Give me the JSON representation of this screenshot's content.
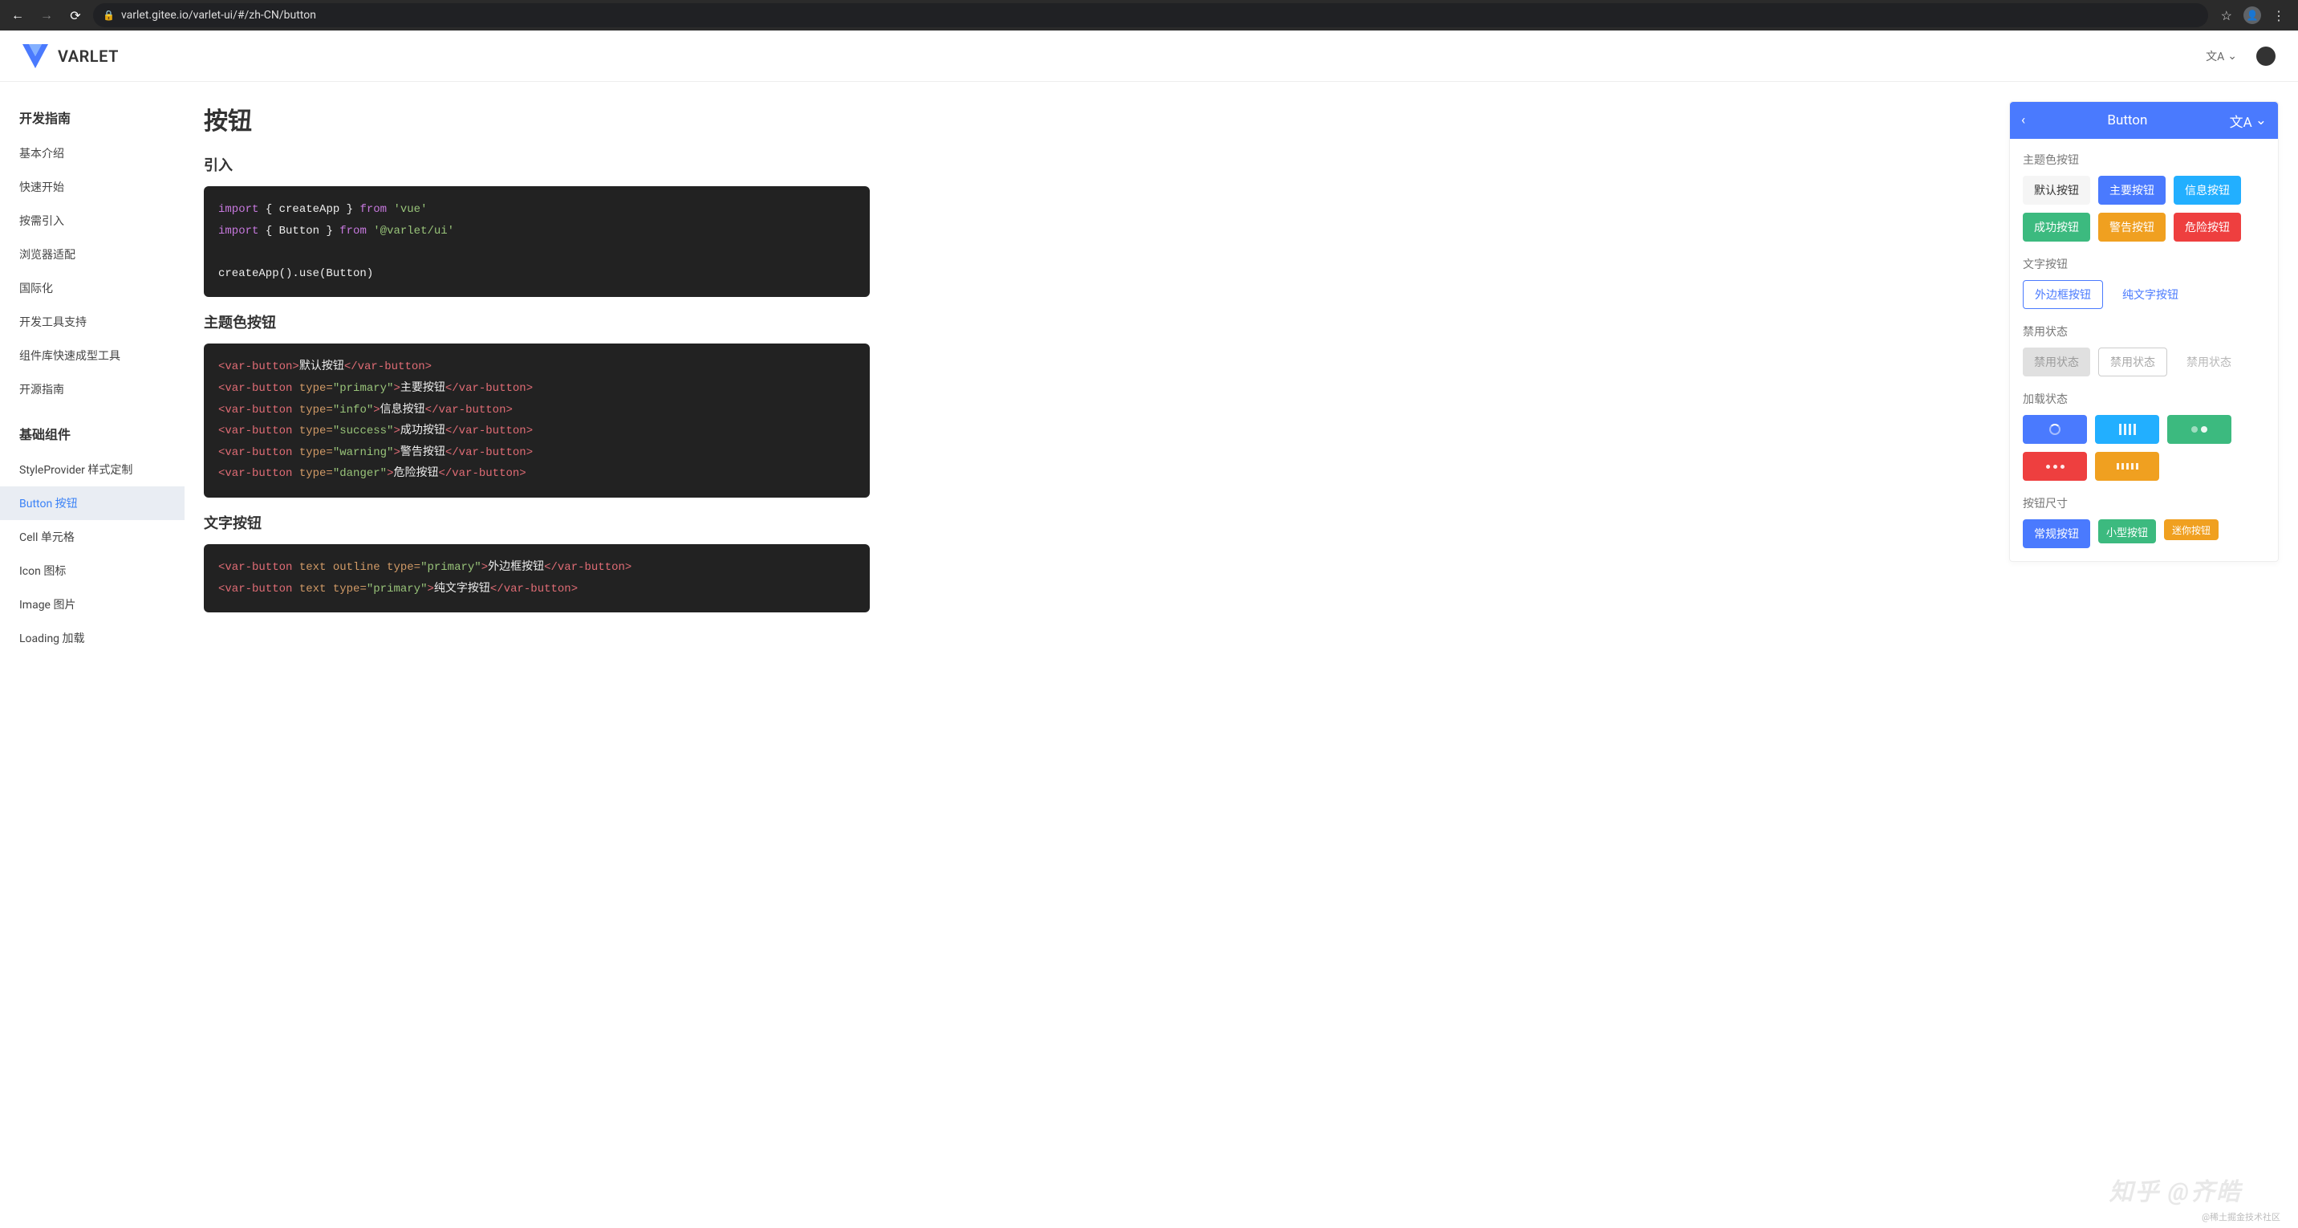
{
  "browser": {
    "url": "varlet.gitee.io/varlet-ui/#/zh-CN/button"
  },
  "header": {
    "brand": "VARLET"
  },
  "sidebar": {
    "section1_title": "开发指南",
    "section1_items": [
      "基本介绍",
      "快速开始",
      "按需引入",
      "浏览器适配",
      "国际化",
      "开发工具支持",
      "组件库快速成型工具",
      "开源指南"
    ],
    "section2_title": "基础组件",
    "section2_items": [
      "StyleProvider 样式定制",
      "Button 按钮",
      "Cell 单元格",
      "Icon 图标",
      "Image 图片",
      "Loading 加载"
    ],
    "active_item": "Button 按钮"
  },
  "page": {
    "title": "按钮",
    "section1": "引入",
    "section2": "主题色按钮",
    "section3": "文字按钮",
    "code1": {
      "l1_kw1": "import",
      "l1_braces": "{ createApp }",
      "l1_kw2": "from",
      "l1_str": "'vue'",
      "l2_kw1": "import",
      "l2_braces": "{ Button }",
      "l2_kw2": "from",
      "l2_str": "'@varlet/ui'",
      "l3": "createApp().use(Button)"
    },
    "code2": {
      "lines": [
        {
          "open": "<var-button>",
          "text": "默认按钮",
          "close": "</var-button>"
        },
        {
          "open": "<var-button ",
          "attr": "type=",
          "val": "\"primary\"",
          "gt": ">",
          "text": "主要按钮",
          "close": "</var-button>"
        },
        {
          "open": "<var-button ",
          "attr": "type=",
          "val": "\"info\"",
          "gt": ">",
          "text": "信息按钮",
          "close": "</var-button>"
        },
        {
          "open": "<var-button ",
          "attr": "type=",
          "val": "\"success\"",
          "gt": ">",
          "text": "成功按钮",
          "close": "</var-button>"
        },
        {
          "open": "<var-button ",
          "attr": "type=",
          "val": "\"warning\"",
          "gt": ">",
          "text": "警告按钮",
          "close": "</var-button>"
        },
        {
          "open": "<var-button ",
          "attr": "type=",
          "val": "\"danger\"",
          "gt": ">",
          "text": "危险按钮",
          "close": "</var-button>"
        }
      ]
    },
    "code3": {
      "lines": [
        {
          "open": "<var-button ",
          "attrs": "text outline ",
          "attr": "type=",
          "val": "\"primary\"",
          "gt": ">",
          "text": "外边框按钮",
          "close": "</var-button>"
        },
        {
          "open": "<var-button ",
          "attrs": "text ",
          "attr": "type=",
          "val": "\"primary\"",
          "gt": ">",
          "text": "纯文字按钮",
          "close": "</var-button>"
        }
      ]
    }
  },
  "preview": {
    "title": "Button",
    "groups": {
      "theme": {
        "label": "主题色按钮",
        "buttons": [
          "默认按钮",
          "主要按钮",
          "信息按钮",
          "成功按钮",
          "警告按钮",
          "危险按钮"
        ]
      },
      "text": {
        "label": "文字按钮",
        "buttons": [
          "外边框按钮",
          "纯文字按钮"
        ]
      },
      "disabled": {
        "label": "禁用状态",
        "buttons": [
          "禁用状态",
          "禁用状态",
          "禁用状态"
        ]
      },
      "loading": {
        "label": "加载状态"
      },
      "size": {
        "label": "按钮尺寸",
        "buttons": [
          "常规按钮",
          "小型按钮",
          "迷你按钮"
        ]
      }
    }
  },
  "watermark": {
    "small": "@稀土掘金技术社区",
    "large": "知乎 @齐皓"
  }
}
